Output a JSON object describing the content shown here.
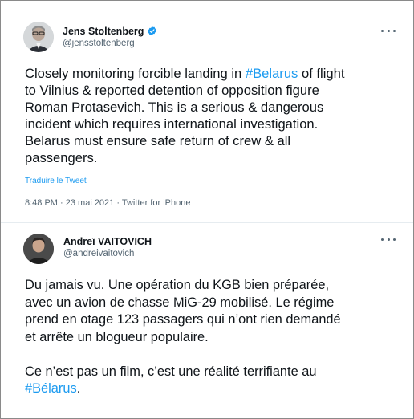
{
  "tweets": [
    {
      "author_name": "Jens Stoltenberg",
      "handle": "@jensstoltenberg",
      "verified": true,
      "text_lines": [
        {
          "before": "Closely monitoring forcible landing in ",
          "hashtag": "#Belarus",
          "after": " of flight"
        },
        {
          "before": "to Vilnius & reported detention of opposition figure",
          "hashtag": "",
          "after": ""
        },
        {
          "before": "Roman Protasevich. This is a serious & dangerous",
          "hashtag": "",
          "after": ""
        },
        {
          "before": "incident which requires international investigation.",
          "hashtag": "",
          "after": ""
        },
        {
          "before": "Belarus must ensure safe return of crew & all",
          "hashtag": "",
          "after": ""
        },
        {
          "before": "passengers.",
          "hashtag": "",
          "after": ""
        }
      ],
      "translate_label": "Traduire le Tweet",
      "meta": "8:48 PM · 23 mai 2021 · Twitter for iPhone"
    },
    {
      "author_name": "Andreï VAITOVICH",
      "handle": "@andreivaitovich",
      "verified": false,
      "text_lines": [
        {
          "before": "Du jamais vu. Une opération du KGB bien préparée,",
          "hashtag": "",
          "after": ""
        },
        {
          "before": "avec un avion de chasse MiG-29 mobilisé. Le régime",
          "hashtag": "",
          "after": ""
        },
        {
          "before": "prend en otage 123 passagers qui n’ont rien demandé",
          "hashtag": "",
          "after": ""
        },
        {
          "before": "et arrête un blogueur populaire.",
          "hashtag": "",
          "after": ""
        },
        {
          "before": "",
          "hashtag": "",
          "after": ""
        },
        {
          "before": "Ce n’est pas un film, c’est une réalité terrifiante au",
          "hashtag": "",
          "after": ""
        },
        {
          "before": "",
          "hashtag": "#Bélarus",
          "after": "."
        }
      ]
    }
  ],
  "colors": {
    "hashtag": "#1d9bf0",
    "verified": "#1d9bf0",
    "secondary_text": "#536471",
    "divider": "#e6ecf0"
  },
  "icons": [
    "verified-badge-icon",
    "more-options-icon"
  ]
}
